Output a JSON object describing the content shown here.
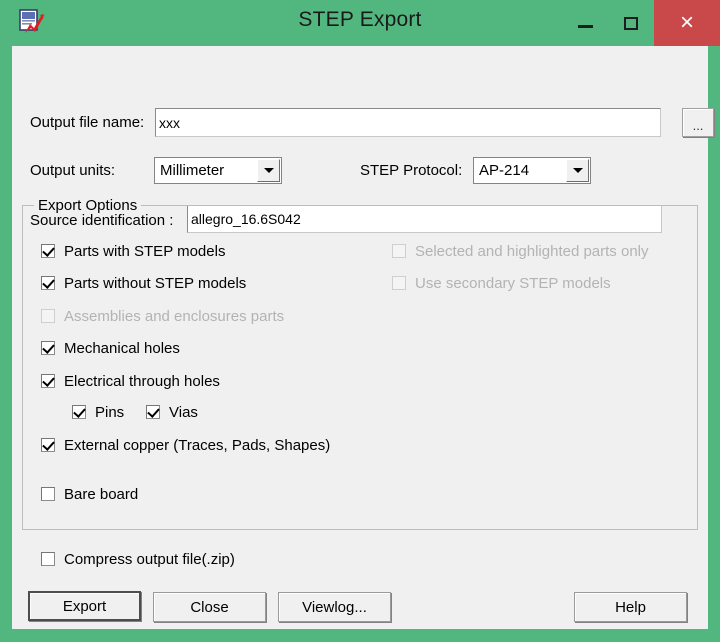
{
  "window": {
    "title": "STEP Export",
    "icon": "step-export-app-icon",
    "colors": {
      "titlebar_green": "#52b77e",
      "close_red": "#c9484a",
      "dialog_background": "#f0f0f0"
    },
    "controls": {
      "minimize": "minimize-icon",
      "maximize": "maximize-icon",
      "close": "×"
    }
  },
  "fields": {
    "output_file_name": {
      "label": "Output file name:",
      "value": "xxx",
      "placeholder": ""
    },
    "browse": {
      "label": "..."
    },
    "output_units": {
      "label": "Output units:",
      "value": "Millimeter",
      "options": [
        "Millimeter"
      ]
    },
    "step_protocol": {
      "label": "STEP Protocol:",
      "value": "AP-214",
      "options": [
        "AP-214"
      ]
    },
    "source_identification": {
      "label": "Source identification :",
      "value": "allegro_16.6S042",
      "placeholder": ""
    }
  },
  "export_options": {
    "group_title": "Export Options",
    "left_column": [
      {
        "label": "Parts with STEP models",
        "checked": true,
        "disabled": false
      },
      {
        "label": "Parts without STEP models",
        "checked": true,
        "disabled": false
      },
      {
        "label": "Assemblies and enclosures parts",
        "checked": false,
        "disabled": true
      },
      {
        "label": "Mechanical holes",
        "checked": true,
        "disabled": false
      },
      {
        "label": "Electrical through holes",
        "checked": true,
        "disabled": false
      },
      {
        "label": "External copper (Traces, Pads, Shapes)",
        "checked": true,
        "disabled": false
      },
      {
        "label": "Bare board",
        "checked": false,
        "disabled": false
      }
    ],
    "sub_options": [
      {
        "label": "Pins",
        "checked": true,
        "disabled": false
      },
      {
        "label": "Vias",
        "checked": true,
        "disabled": false
      }
    ],
    "right_column": [
      {
        "label": "Selected and highlighted parts only",
        "checked": false,
        "disabled": true
      },
      {
        "label": "Use secondary STEP models",
        "checked": false,
        "disabled": true
      }
    ]
  },
  "compress": {
    "label": "Compress output file(.zip)",
    "checked": false
  },
  "buttons": {
    "export": "Export",
    "close": "Close",
    "viewlog": "Viewlog...",
    "help": "Help"
  }
}
